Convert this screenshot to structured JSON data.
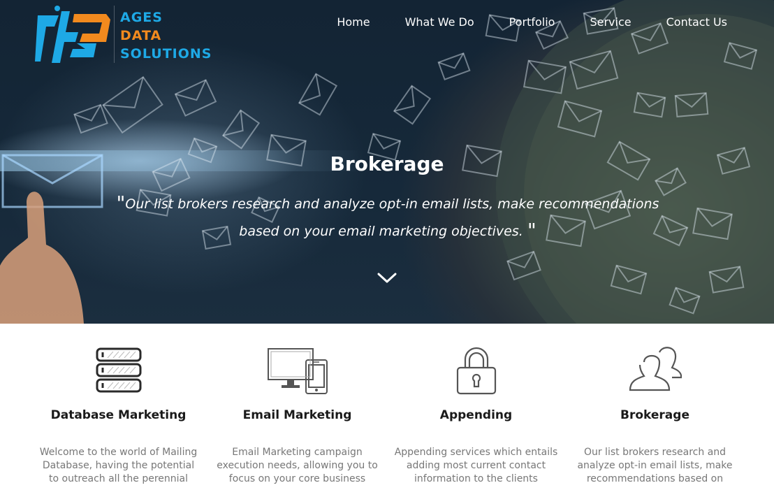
{
  "brand": {
    "line1": "AGES",
    "line2": "DATA",
    "line3": "SOLUTIONS",
    "colors": {
      "blue": "#1ea9e6",
      "orange": "#f28a1e"
    }
  },
  "nav": {
    "items": [
      {
        "label": "Home"
      },
      {
        "label": "What We Do"
      },
      {
        "label": "Portfolio"
      },
      {
        "label": "Service"
      },
      {
        "label": "Contact Us"
      }
    ]
  },
  "hero": {
    "title": "Brokerage",
    "open_quote": "\"",
    "quote": "Our list brokers research and analyze opt-in email lists, make recommendations based on your email marketing objectives.",
    "close_quote": "\"",
    "scroll_icon": "chevron-down-icon"
  },
  "services": [
    {
      "icon": "database-icon",
      "title": "Database Marketing",
      "description": "Welcome to the world of Mailing Database, having the potential to outreach all the perennial"
    },
    {
      "icon": "devices-icon",
      "title": "Email Marketing",
      "description": "Email Marketing campaign execution needs, allowing you to focus on your core business"
    },
    {
      "icon": "lock-icon",
      "title": "Appending",
      "description": "Appending services which entails adding most current contact information to the clients"
    },
    {
      "icon": "users-icon",
      "title": "Brokerage",
      "description": "Our list brokers research and analyze opt-in email lists, make recommendations based on"
    }
  ]
}
